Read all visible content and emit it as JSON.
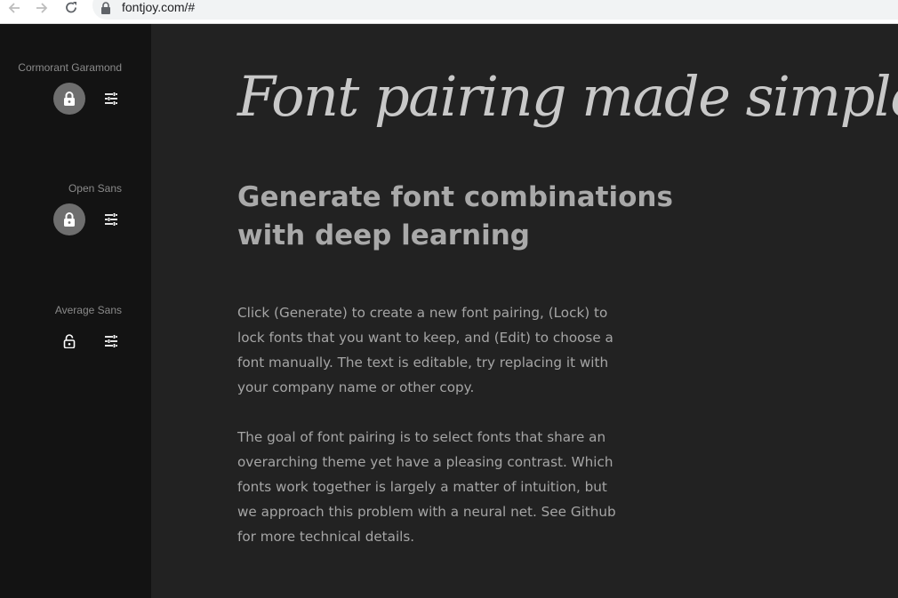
{
  "browser": {
    "url": "fontjoy.com/#"
  },
  "sidebar": {
    "fonts": [
      {
        "name": "Cormorant Garamond",
        "locked": true
      },
      {
        "name": "Open Sans",
        "locked": true
      },
      {
        "name": "Average Sans",
        "locked": false
      }
    ]
  },
  "main": {
    "headline": "Font pairing made simple",
    "subheading": "Generate font combinations with deep learning",
    "paragraphs": [
      "Click (Generate) to create a new font pairing, (Lock) to lock fonts that you want to keep, and (Edit) to choose a font manually. The text is editable, try replacing it with your company name or other copy.",
      "The goal of font pairing is to select fonts that share an overarching theme yet have a pleasing contrast. Which fonts work together is largely a matter of intuition, but we approach this problem with a neural net. See Github for more technical details."
    ]
  },
  "colors": {
    "sidebar_bg": "#131313",
    "main_bg": "#222222",
    "lock_active_bg": "#6e6e6e",
    "headline_text": "#c8c8c8",
    "body_text": "#a5a5a5"
  }
}
